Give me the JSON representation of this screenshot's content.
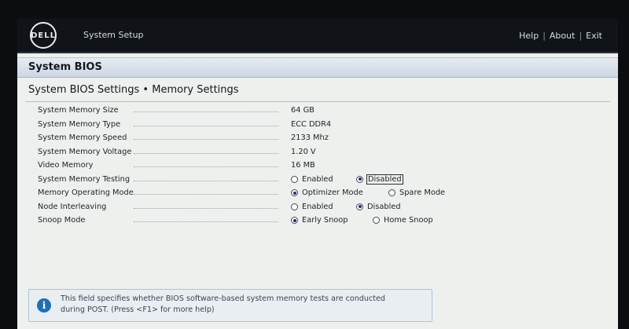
{
  "topbar": {
    "logo_text": "DELL",
    "app_title": "System Setup",
    "links": {
      "help": "Help",
      "about": "About",
      "exit": "Exit"
    },
    "separator": "|"
  },
  "section": {
    "title": "System BIOS"
  },
  "page": {
    "title": "System BIOS Settings • Memory Settings"
  },
  "settings": [
    {
      "label": "System Memory Size",
      "value": "64 GB"
    },
    {
      "label": "System Memory Type",
      "value": "ECC DDR4"
    },
    {
      "label": "System Memory Speed",
      "value": "2133 Mhz"
    },
    {
      "label": "System Memory Voltage",
      "value": "1.20 V"
    },
    {
      "label": "Video Memory",
      "value": "16 MB"
    },
    {
      "label": "System Memory Testing",
      "options": [
        {
          "label": "Enabled",
          "selected": false
        },
        {
          "label": "Disabled",
          "selected": true
        }
      ]
    },
    {
      "label": "Memory Operating Mode",
      "options": [
        {
          "label": "Optimizer Mode",
          "selected": true
        },
        {
          "label": "Spare Mode",
          "selected": false
        }
      ]
    },
    {
      "label": "Node Interleaving",
      "options": [
        {
          "label": "Enabled",
          "selected": false
        },
        {
          "label": "Disabled",
          "selected": true
        }
      ]
    },
    {
      "label": "Snoop Mode",
      "options": [
        {
          "label": "Early Snoop",
          "selected": true
        },
        {
          "label": "Home Snoop",
          "selected": false
        }
      ]
    }
  ],
  "help": {
    "icon": "info-icon",
    "line1": "This field specifies whether BIOS software-based system memory tests are conducted",
    "line2": "during POST. (Press <F1> for more help)"
  },
  "colors": {
    "accent": "#1f6fb8",
    "header_bar": "#101418",
    "radio_fill": "#1d2e8c"
  }
}
